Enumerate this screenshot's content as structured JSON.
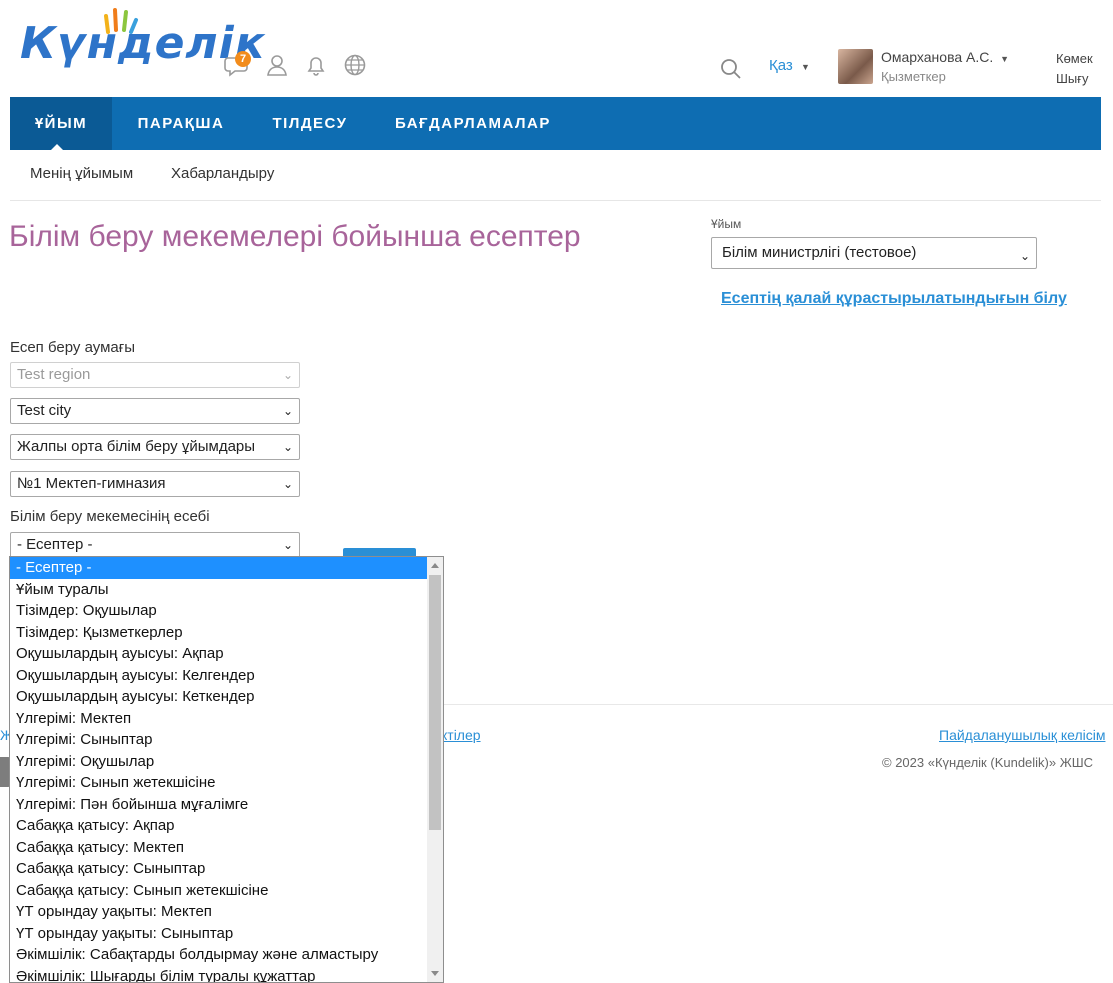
{
  "header": {
    "logo": "Күнделік",
    "notification_count": "7",
    "language": "Қаз",
    "user_name": "Омарханова А.С.",
    "user_role": "Қызметкер",
    "help": "Көмек",
    "exit": "Шығу",
    "icons": [
      "chat-icon",
      "user-icon",
      "bell-icon",
      "globe-icon",
      "search-icon"
    ]
  },
  "nav": {
    "items": [
      {
        "label": "ҰЙЫМ",
        "active": true
      },
      {
        "label": "ПАРАҚША"
      },
      {
        "label": "ТІЛДЕСУ"
      },
      {
        "label": "БАҒДАРЛАМАЛАР"
      }
    ],
    "subitems": [
      "Менің ұйымым",
      "Хабарландыру"
    ]
  },
  "page": {
    "title": "Білім беру мекемелері бойынша есептер",
    "org_label": "Ұйым",
    "org_value": "Білім министрлігі (тестовое)",
    "how_link": "Есептің қалай құрастырылатындығын білу",
    "region_label": "Есеп беру аумағы",
    "region_value": "Test region",
    "city_value": "Test city",
    "org_type_value": "Жалпы орта білім беру ұйымдары",
    "school_value": "№1 Мектеп-гимназия",
    "report_label": "Білім беру мекемесінің есебі",
    "report_value": "- Есептер -"
  },
  "dropdown": {
    "options": [
      "- Есептер -",
      "Ұйым туралы",
      "Тізімдер: Оқушылар",
      "Тізімдер: Қызметкерлер",
      "Оқушылардың ауысуы: Ақпар",
      "Оқушылардың ауысуы: Келгендер",
      "Оқушылардың ауысуы: Кеткендер",
      "Үлгерімі: Мектеп",
      "Үлгерімі: Сыныптар",
      "Үлгерімі: Оқушылар",
      "Үлгерімі: Сынып жетекшісіне",
      "Үлгерімі: Пән бойынша мұғалімге",
      "Сабаққа қатысу: Ақпар",
      "Сабаққа қатысу: Мектеп",
      "Сабаққа қатысу: Сыныптар",
      "Сабаққа қатысу: Сынып жетекшісіне",
      "ҮТ орындау уақыты: Мектеп",
      "ҮТ орындау уақыты: Сыныптар",
      "Әкімшілік: Сабақтарды болдырмау және алмастыру",
      "Әкімшілік: Шығарды білім туралы құжаттар"
    ]
  },
  "footer": {
    "left_fragment": "Ж",
    "mid_fragment": "ктілер",
    "terms": "Пайдаланушылық келісім",
    "copyright": "© 2023 «Күнделік (Kundelik)» ЖШС"
  }
}
